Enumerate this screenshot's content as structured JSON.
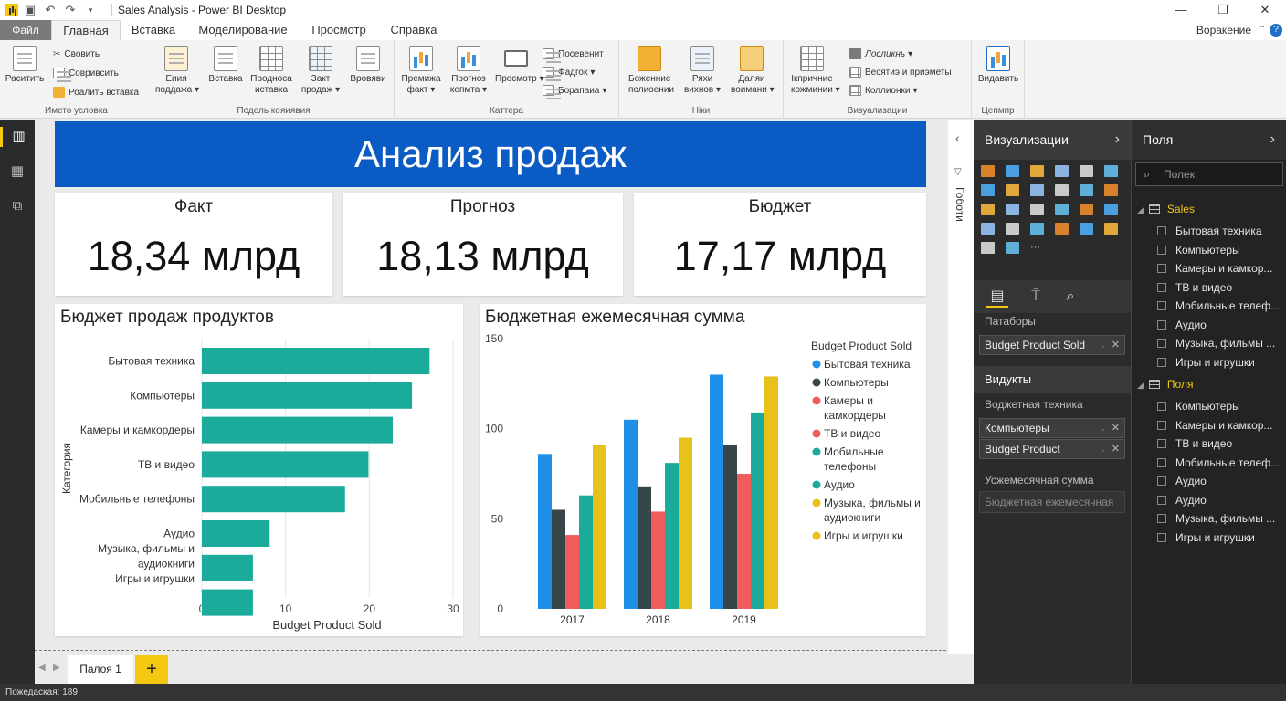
{
  "app": {
    "title": "Sales Analysis - Power BI Desktop",
    "status": "Пожедаская: 189"
  },
  "tabs": {
    "file": "Файл",
    "home": "Главная",
    "insert": "Вставка",
    "modeling": "Моделирование",
    "view": "Просмотр",
    "help": "Справка",
    "right": "Воракение"
  },
  "ribbon": {
    "clipboard": {
      "paste": "Раситить",
      "cut": "Свовить",
      "copy": "Совривсить",
      "format": "Роалить вставка",
      "label": "Името условка"
    },
    "data": {
      "b1a": "Еиия",
      "b1b": "поддажа",
      "b2a": "Вставка",
      "b3a": "Продноса",
      "b3b": "иставка",
      "b4a": "Закт",
      "b4b": "продаж",
      "b5a": "Вровяви",
      "label": "Подель кояиявия"
    },
    "insert": {
      "b1a": "Премижа",
      "b1b": "факт",
      "b2a": "Прогноз",
      "b2b": "кепмта",
      "b3a": "Просмотр",
      "s1": "Посевенит",
      "s2": "Фадгок",
      "s3": "Борапаиа",
      "label": "Каттера"
    },
    "calc": {
      "b1a": "Боженние",
      "b1b": "полиоении",
      "b2a": "Ряхи",
      "b2b": "вихнов",
      "b3a": "Даляи",
      "b3b": "воимани",
      "label": "Ніки"
    },
    "viz": {
      "b1a": "Ікпричние",
      "b1b": "кожминии",
      "s1": "Лосликнь",
      "s2": "Весятиэ и приэметы",
      "s3": "Коллионки",
      "label": "Визуализации"
    },
    "share": {
      "b1a": "Видавить",
      "label": "Цепмпр"
    }
  },
  "report": {
    "title": "Анализ продаж",
    "cards": [
      {
        "label": "Факт",
        "value": "18,34 млрд"
      },
      {
        "label": "Прогноз",
        "value": "18,13 млрд"
      },
      {
        "label": "Бюджет",
        "value": "17,17 млрд"
      }
    ],
    "filters_label": "Гоботи"
  },
  "chart_data": [
    {
      "type": "bar",
      "orientation": "horizontal",
      "title": "Бюджет продаж продуктов",
      "xlabel": "Budget Product Sold",
      "ylabel": "Категория",
      "categories": [
        "Бытовая техника",
        "Компьютеры",
        "Камеры и камкордеры",
        "ТВ и видео",
        "Мобильные телефоны",
        "Аудио",
        "Музыка, фильмы и аудиокниги",
        "Игры и игрушки"
      ],
      "category_lines": [
        [
          "Бытовая техника"
        ],
        [
          "Компьютеры"
        ],
        [
          "Камеры и камкордеры"
        ],
        [
          "ТВ и видео"
        ],
        [
          "Мобильные телефоны"
        ],
        [
          "Аудио",
          "Музыка, фильмы и",
          "аудиокниги",
          "Игры и игрушки"
        ]
      ],
      "values": [
        27.2,
        25.1,
        22.8,
        19.9,
        17.1,
        8.1,
        6.1,
        6.1
      ],
      "xlim": [
        0,
        30
      ],
      "xticks": [
        "0",
        "10",
        "20",
        "30"
      ],
      "color": "#1aab9b",
      "grid": true
    },
    {
      "type": "bar",
      "orientation": "vertical",
      "title": "Бюджетная ежемесячная сумма",
      "categories": [
        "2017",
        "2018",
        "2019"
      ],
      "ylim": [
        0,
        150
      ],
      "yticks": [
        "0",
        "50",
        "100",
        "150"
      ],
      "grid": false,
      "legend_title": "Budget Product Sold",
      "legend_position": "right",
      "series": [
        {
          "name": "Бытовая техника",
          "lines": [
            "Бытовая техника"
          ],
          "color": "#1f8fe8",
          "values": [
            86,
            105,
            130
          ]
        },
        {
          "name": "Компьютеры",
          "lines": [
            "Компьютеры"
          ],
          "color": "#374649",
          "values": [
            55,
            68,
            91
          ]
        },
        {
          "name": "Камеры и камкордеры",
          "lines": [
            "Камеры и",
            "камкордеры"
          ],
          "color": "#f05b5b",
          "values": [
            41,
            54,
            75
          ]
        },
        {
          "name": "ТВ и видео",
          "lines": [
            "ТВ и видео"
          ],
          "color": "#f05b5b",
          "values": [
            0,
            0,
            0
          ]
        },
        {
          "name": "Мобильные телефоны",
          "lines": [
            "Мобильные",
            "телефоны"
          ],
          "color": "#1aab9b",
          "values": [
            63,
            81,
            109
          ]
        },
        {
          "name": "Аудио",
          "lines": [
            "Аудио"
          ],
          "color": "#1aab9b",
          "values": [
            0,
            0,
            0
          ]
        },
        {
          "name": "Музыка, фильмы и аудиокниги",
          "lines": [
            "Музыка, фильмы и",
            "аудиокниги"
          ],
          "color": "#e8c21a",
          "values": [
            91,
            95,
            129
          ]
        },
        {
          "name": "Игры и игрушки",
          "lines": [
            "Игры и игрушки"
          ],
          "color": "#e8c21a",
          "values": [
            0,
            0,
            0
          ]
        }
      ]
    }
  ],
  "viz_pane": {
    "title": "Визуализации",
    "wells": {
      "w1_label": "Патаборы",
      "w1_field": "Budget Product Sold",
      "section2": "Видукты",
      "w2_label": "Воджетная техника",
      "w2_field1": "Компьютеры",
      "w2_field2": "Budget  Product",
      "w3_label": "Усжемесячная сумма",
      "w3_field": "Бюджетная ежемесячная"
    }
  },
  "fields_pane": {
    "title": "Поля",
    "search_placeholder": "Полек",
    "tables": [
      {
        "name": "Sales",
        "fields": [
          "Бытовая техника",
          "Компьютеры",
          "Камеры и камкор...",
          "ТВ и видео",
          "Мобильные телеф...",
          "Аудио",
          "Музыка, фильмы ...",
          "Игры и игрушки"
        ]
      },
      {
        "name": "Поля",
        "fields": [
          "Компьютеры",
          "Камеры и камкор...",
          "ТВ и видео",
          "Мобильные телеф...",
          "Аудио",
          "Аудио",
          "Музыка, фильмы ...",
          "Игры и игрушки"
        ]
      }
    ]
  },
  "pages": {
    "tab1": "Палоя 1",
    "add": "+"
  }
}
